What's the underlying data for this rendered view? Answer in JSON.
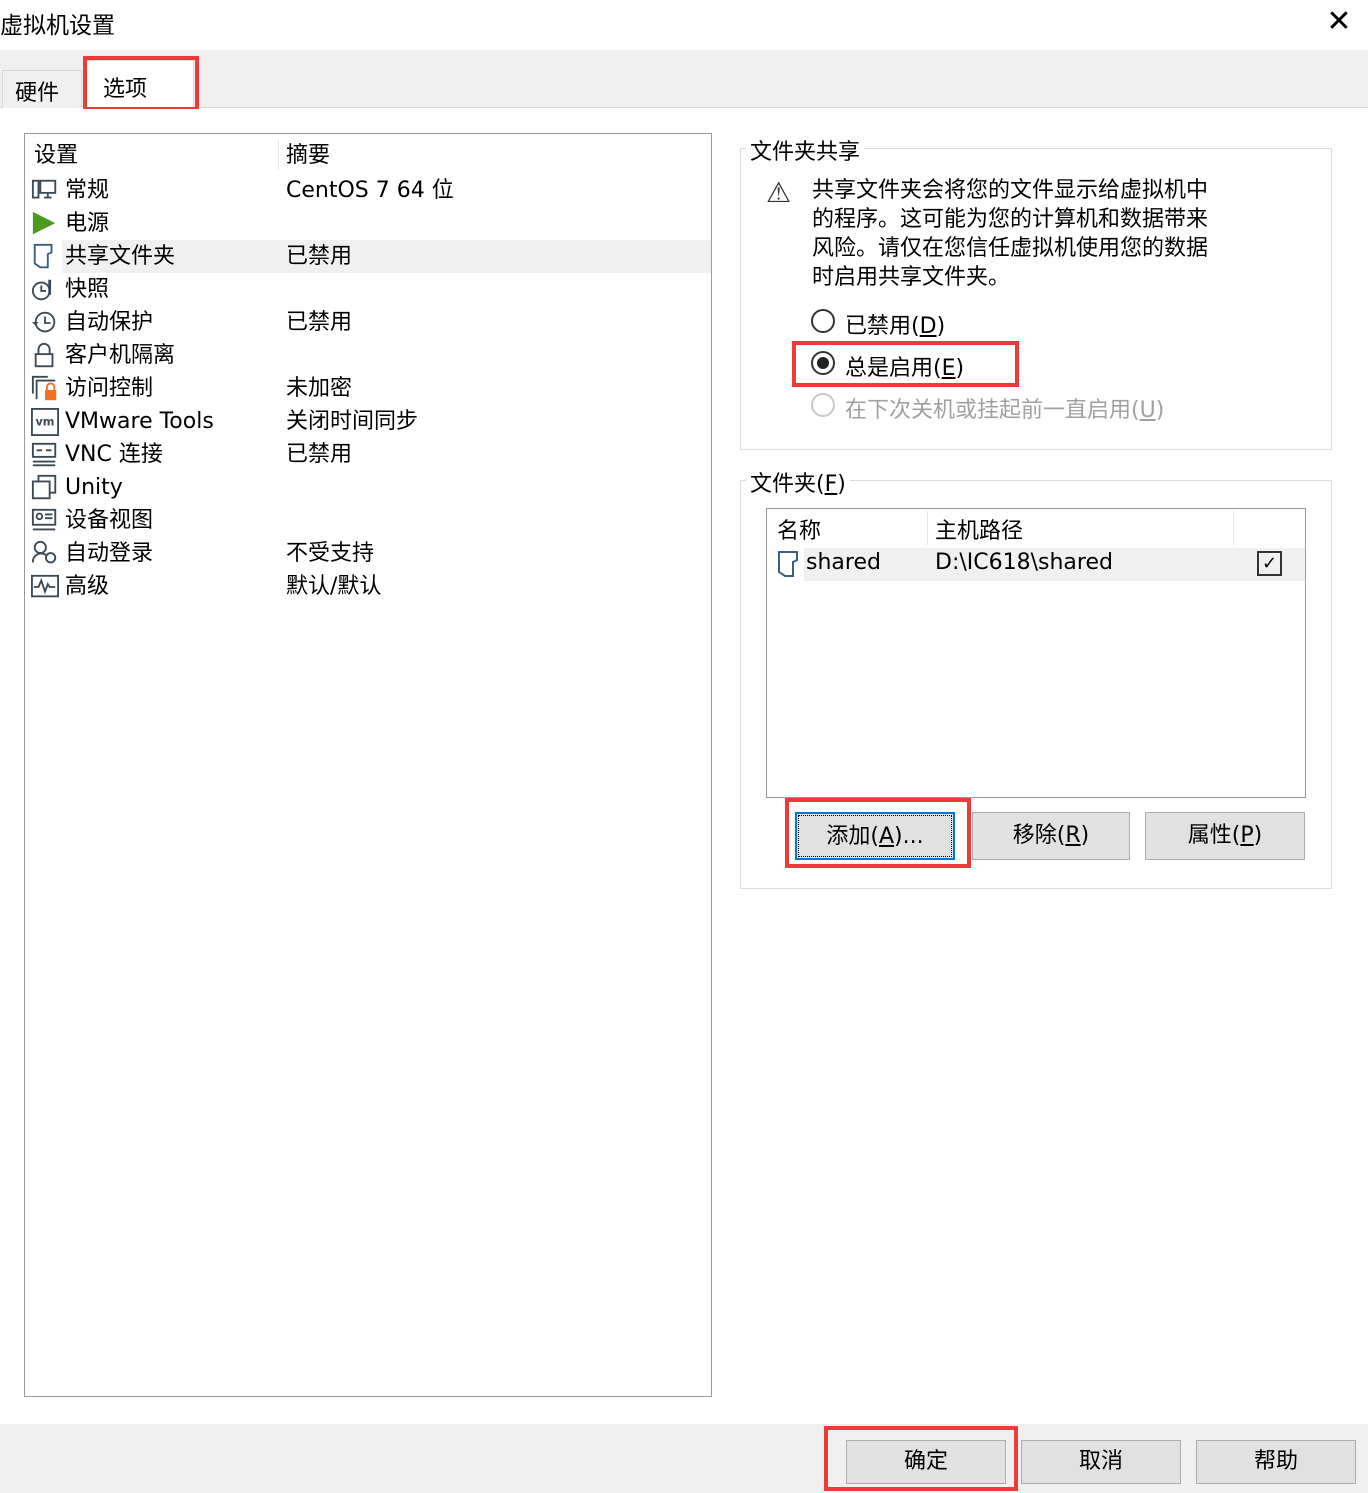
{
  "window": {
    "title": "虚拟机设置"
  },
  "tabs": [
    {
      "label": "硬件"
    },
    {
      "label": "选项",
      "selected": true
    }
  ],
  "settings_list": {
    "headers": {
      "setting": "设置",
      "summary": "摘要"
    },
    "items": [
      {
        "name": "常规",
        "summary": "CentOS 7 64 位",
        "icon": "monitor-icon"
      },
      {
        "name": "电源",
        "summary": "",
        "icon": "play-icon"
      },
      {
        "name": "共享文件夹",
        "summary": "已禁用",
        "icon": "shared-folder-icon",
        "selected": true
      },
      {
        "name": "快照",
        "summary": "",
        "icon": "snapshot-icon"
      },
      {
        "name": "自动保护",
        "summary": "已禁用",
        "icon": "clock-history-icon"
      },
      {
        "name": "客户机隔离",
        "summary": "",
        "icon": "lock-icon"
      },
      {
        "name": "访问控制",
        "summary": "未加密",
        "icon": "access-control-icon"
      },
      {
        "name": "VMware Tools",
        "summary": "关闭时间同步",
        "icon": "vm-icon"
      },
      {
        "name": "VNC 连接",
        "summary": "已禁用",
        "icon": "vnc-icon"
      },
      {
        "name": "Unity",
        "summary": "",
        "icon": "unity-icon"
      },
      {
        "name": "设备视图",
        "summary": "",
        "icon": "device-view-icon"
      },
      {
        "name": "自动登录",
        "summary": "不受支持",
        "icon": "autologin-icon"
      },
      {
        "name": "高级",
        "summary": "默认/默认",
        "icon": "advanced-icon"
      }
    ]
  },
  "folder_sharing": {
    "title": "文件夹共享",
    "warning_lines": [
      "共享文件夹会将您的文件显示给虚拟机中",
      "的程序。这可能为您的计算机和数据带来",
      "风险。请仅在您信任虚拟机使用您的数据",
      "时启用共享文件夹。"
    ],
    "options": [
      {
        "label": "已禁用",
        "key": "D",
        "checked": false,
        "disabled": false
      },
      {
        "label": "总是启用",
        "key": "E",
        "checked": true,
        "disabled": false
      },
      {
        "label": "在下次关机或挂起前一直启用",
        "key": "U",
        "checked": false,
        "disabled": true
      }
    ]
  },
  "folders": {
    "title": "文件夹(",
    "title_key": "F",
    "title_end": ")",
    "headers": {
      "name": "名称",
      "path": "主机路径"
    },
    "rows": [
      {
        "name": "shared",
        "path": "D:\\IC618\\shared",
        "enabled": true
      }
    ],
    "buttons": {
      "add": "添加(",
      "add_key": "A",
      "add_end": ")...",
      "remove": "移除(",
      "remove_key": "R",
      "remove_end": ")",
      "props": "属性(",
      "props_key": "P",
      "props_end": ")"
    }
  },
  "footer": {
    "ok": "确定",
    "cancel": "取消",
    "help": "帮助"
  },
  "colors": {
    "highlight": "#f03a3a",
    "play": "#4b9a1e",
    "lock_orange": "#f36f21"
  }
}
